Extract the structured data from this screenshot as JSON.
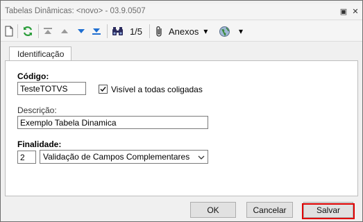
{
  "window": {
    "title": "Tabelas Dinâmicas: <novo> - 03.9.0507",
    "restore_glyph": "▣",
    "close_glyph": "✕"
  },
  "toolbar": {
    "page_indicator": "1/5",
    "attachments_label": "Anexos",
    "dropdown_glyph": "▾",
    "icons": [
      "new-document-icon",
      "refresh-icon",
      "first-record-icon",
      "previous-record-icon",
      "next-record-icon",
      "last-record-icon",
      "binoculars-icon",
      "paperclip-icon",
      "globe-icon"
    ]
  },
  "tabs": [
    {
      "label": "Identificação",
      "active": true
    }
  ],
  "form": {
    "codigo_label": "Código:",
    "codigo_value": "TesteTOTVS",
    "visivel_label": "Visível a todas coligadas",
    "visivel_checked": true,
    "descricao_label": "Descrição:",
    "descricao_value": "Exemplo Tabela Dinamica",
    "finalidade_label": "Finalidade:",
    "finalidade_code": "2",
    "finalidade_option": "Validação de Campos Complementares"
  },
  "buttons": {
    "ok": "OK",
    "cancel": "Cancelar",
    "save": "Salvar"
  },
  "colors": {
    "highlight": "#e00000",
    "accent_blue": "#1f6fd1",
    "green": "#2a9d3a"
  }
}
